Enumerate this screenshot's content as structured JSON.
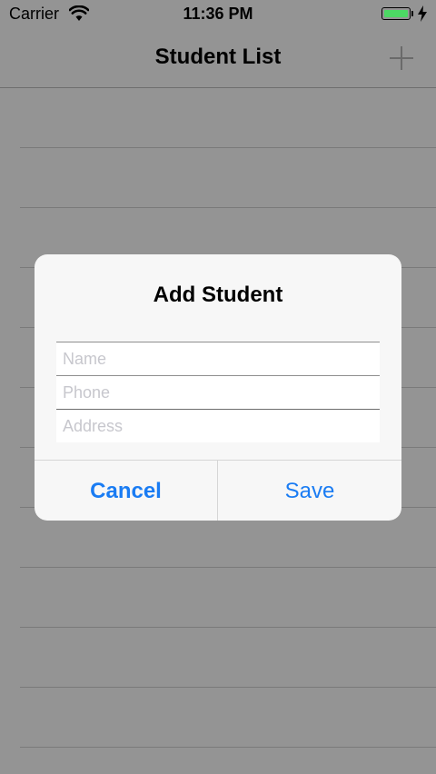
{
  "status_bar": {
    "carrier": "Carrier",
    "time": "11:36 PM",
    "battery_color": "#4cd964"
  },
  "nav_bar": {
    "title": "Student List",
    "add_icon": "plus-icon"
  },
  "table": {
    "row_count": 11
  },
  "alert": {
    "title": "Add Student",
    "fields": [
      {
        "placeholder": "Name",
        "value": ""
      },
      {
        "placeholder": "Phone",
        "value": ""
      },
      {
        "placeholder": "Address",
        "value": ""
      }
    ],
    "cancel_label": "Cancel",
    "save_label": "Save",
    "accent_color": "#1a7cf3"
  }
}
